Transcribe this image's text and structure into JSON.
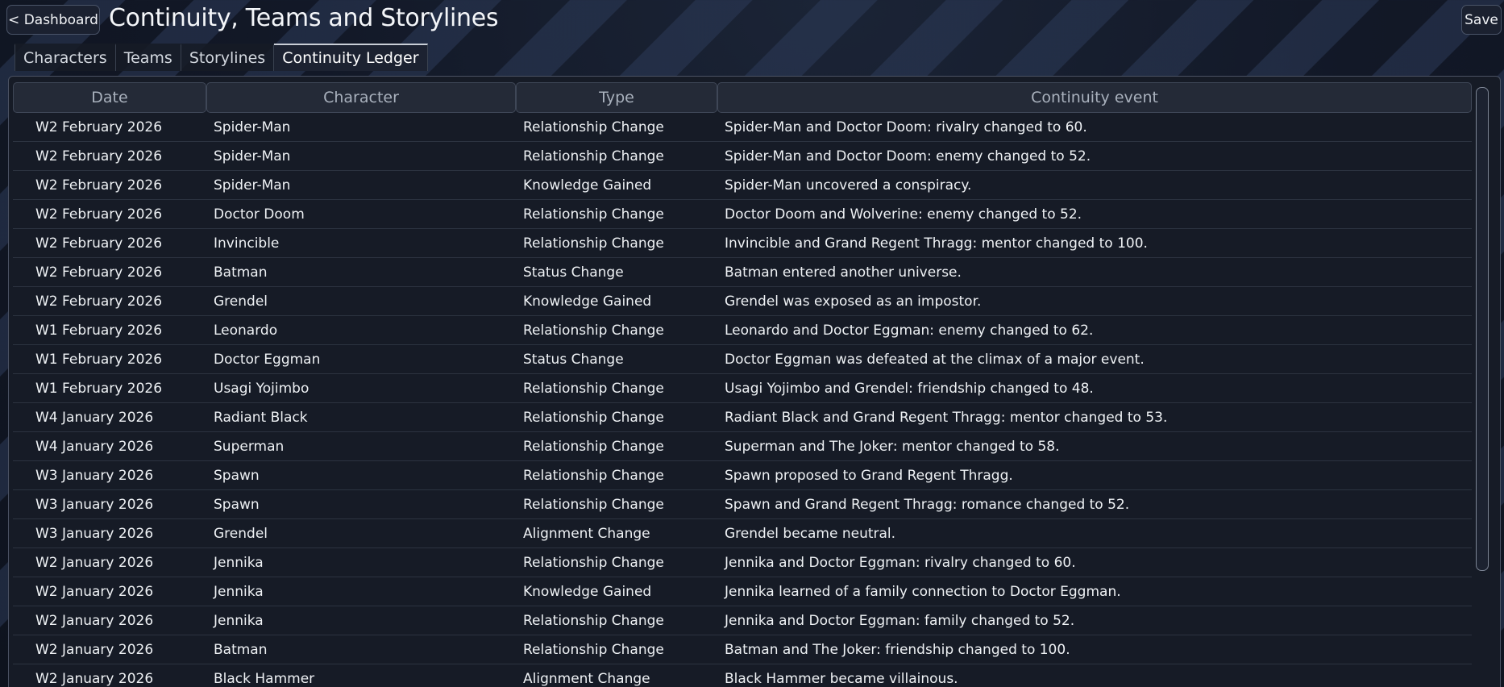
{
  "header": {
    "back_label": "< Dashboard",
    "title": "Continuity, Teams and Storylines",
    "save_label": "Save"
  },
  "tabs": [
    {
      "label": "Characters",
      "active": false
    },
    {
      "label": "Teams",
      "active": false
    },
    {
      "label": "Storylines",
      "active": false
    },
    {
      "label": "Continuity Ledger",
      "active": true
    }
  ],
  "ledger": {
    "columns": [
      "Date",
      "Character",
      "Type",
      "Continuity event"
    ],
    "rows": [
      [
        "W2 February 2026",
        "Spider-Man",
        "Relationship Change",
        "Spider-Man and Doctor Doom: rivalry changed to 60."
      ],
      [
        "W2 February 2026",
        "Spider-Man",
        "Relationship Change",
        "Spider-Man and Doctor Doom: enemy changed to 52."
      ],
      [
        "W2 February 2026",
        "Spider-Man",
        "Knowledge Gained",
        "Spider-Man uncovered a conspiracy."
      ],
      [
        "W2 February 2026",
        "Doctor Doom",
        "Relationship Change",
        "Doctor Doom and Wolverine: enemy changed to 52."
      ],
      [
        "W2 February 2026",
        "Invincible",
        "Relationship Change",
        "Invincible and Grand Regent Thragg: mentor changed to 100."
      ],
      [
        "W2 February 2026",
        "Batman",
        "Status Change",
        "Batman entered another universe."
      ],
      [
        "W2 February 2026",
        "Grendel",
        "Knowledge Gained",
        "Grendel was exposed as an impostor."
      ],
      [
        "W1 February 2026",
        "Leonardo",
        "Relationship Change",
        "Leonardo and Doctor Eggman: enemy changed to 62."
      ],
      [
        "W1 February 2026",
        "Doctor Eggman",
        "Status Change",
        "Doctor Eggman was defeated at the climax of a major event."
      ],
      [
        "W1 February 2026",
        "Usagi Yojimbo",
        "Relationship Change",
        "Usagi Yojimbo and Grendel: friendship changed to 48."
      ],
      [
        "W4 January 2026",
        "Radiant Black",
        "Relationship Change",
        "Radiant Black and Grand Regent Thragg: mentor changed to 53."
      ],
      [
        "W4 January 2026",
        "Superman",
        "Relationship Change",
        "Superman and The Joker: mentor changed to 58."
      ],
      [
        "W3 January 2026",
        "Spawn",
        "Relationship Change",
        "Spawn proposed to Grand Regent Thragg."
      ],
      [
        "W3 January 2026",
        "Spawn",
        "Relationship Change",
        "Spawn and Grand Regent Thragg: romance changed to 52."
      ],
      [
        "W3 January 2026",
        "Grendel",
        "Alignment Change",
        "Grendel became neutral."
      ],
      [
        "W2 January 2026",
        "Jennika",
        "Relationship Change",
        "Jennika and Doctor Eggman: rivalry changed to 60."
      ],
      [
        "W2 January 2026",
        "Jennika",
        "Knowledge Gained",
        "Jennika learned of a family connection to Doctor Eggman."
      ],
      [
        "W2 January 2026",
        "Jennika",
        "Relationship Change",
        "Jennika and Doctor Eggman: family changed to 52."
      ],
      [
        "W2 January 2026",
        "Batman",
        "Relationship Change",
        "Batman and The Joker: friendship changed to 100."
      ],
      [
        "W2 January 2026",
        "Black Hammer",
        "Alignment Change",
        "Black Hammer became villainous."
      ]
    ]
  },
  "colors": {
    "background": "#121827",
    "panel": "#161b26",
    "header_cell": "#242a37",
    "text": "#eef1f4",
    "muted_text": "#a9b1bd"
  }
}
